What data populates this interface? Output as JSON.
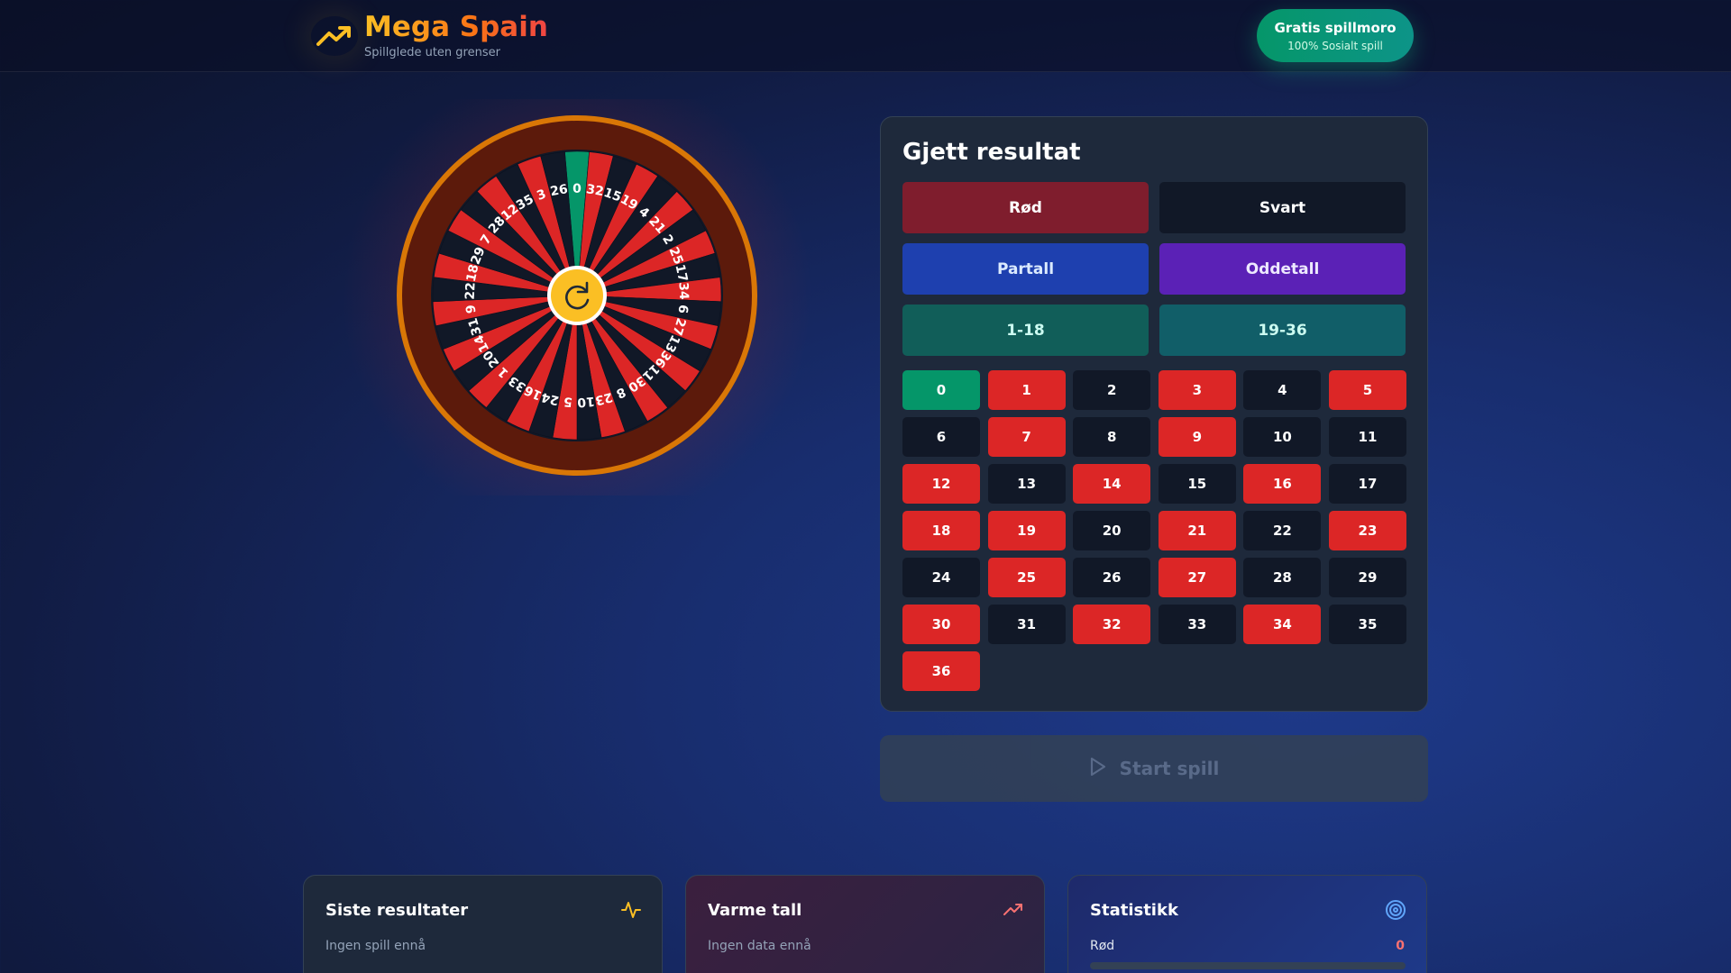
{
  "header": {
    "title": "Mega Spain",
    "subtitle": "Spillglede uten grenser",
    "badge": {
      "title": "Gratis spillmoro",
      "subtitle": "100% Sosialt spill"
    },
    "logo_icon": "trending-up-icon"
  },
  "wheel": {
    "order": [
      0,
      32,
      15,
      19,
      4,
      21,
      2,
      25,
      17,
      34,
      6,
      27,
      13,
      36,
      11,
      30,
      8,
      23,
      10,
      5,
      24,
      16,
      33,
      1,
      20,
      14,
      31,
      9,
      22,
      18,
      29,
      7,
      28,
      12,
      35,
      3,
      26
    ],
    "center_icon": "refresh-icon",
    "colors": {
      "red": "#dc2626",
      "black": "#111827",
      "green": "#059669",
      "rim": "#d97706",
      "frame": "#5c1a0b"
    }
  },
  "guess": {
    "title": "Gjett resultat",
    "options": {
      "red": "Rød",
      "black": "Svart",
      "even": "Partall",
      "odd": "Oddetall",
      "low": "1-18",
      "high": "19-36"
    },
    "numbers": [
      {
        "n": "0",
        "c": "green"
      },
      {
        "n": "1",
        "c": "red"
      },
      {
        "n": "2",
        "c": "black"
      },
      {
        "n": "3",
        "c": "red"
      },
      {
        "n": "4",
        "c": "black"
      },
      {
        "n": "5",
        "c": "red"
      },
      {
        "n": "6",
        "c": "black"
      },
      {
        "n": "7",
        "c": "red"
      },
      {
        "n": "8",
        "c": "black"
      },
      {
        "n": "9",
        "c": "red"
      },
      {
        "n": "10",
        "c": "black"
      },
      {
        "n": "11",
        "c": "black"
      },
      {
        "n": "12",
        "c": "red"
      },
      {
        "n": "13",
        "c": "black"
      },
      {
        "n": "14",
        "c": "red"
      },
      {
        "n": "15",
        "c": "black"
      },
      {
        "n": "16",
        "c": "red"
      },
      {
        "n": "17",
        "c": "black"
      },
      {
        "n": "18",
        "c": "red"
      },
      {
        "n": "19",
        "c": "red"
      },
      {
        "n": "20",
        "c": "black"
      },
      {
        "n": "21",
        "c": "red"
      },
      {
        "n": "22",
        "c": "black"
      },
      {
        "n": "23",
        "c": "red"
      },
      {
        "n": "24",
        "c": "black"
      },
      {
        "n": "25",
        "c": "red"
      },
      {
        "n": "26",
        "c": "black"
      },
      {
        "n": "27",
        "c": "red"
      },
      {
        "n": "28",
        "c": "black"
      },
      {
        "n": "29",
        "c": "black"
      },
      {
        "n": "30",
        "c": "red"
      },
      {
        "n": "31",
        "c": "black"
      },
      {
        "n": "32",
        "c": "red"
      },
      {
        "n": "33",
        "c": "black"
      },
      {
        "n": "34",
        "c": "red"
      },
      {
        "n": "35",
        "c": "black"
      },
      {
        "n": "36",
        "c": "red"
      }
    ]
  },
  "start": {
    "label": "Start spill",
    "icon": "play-icon",
    "disabled": true
  },
  "cards": {
    "recent": {
      "title": "Siste resultater",
      "text": "Ingen spill ennå",
      "icon": "activity-icon"
    },
    "hot": {
      "title": "Varme tall",
      "text": "Ingen data ennå",
      "icon": "trending-up-icon"
    },
    "stats": {
      "title": "Statistikk",
      "label": "Rød",
      "value": "0",
      "icon": "target-icon"
    }
  }
}
